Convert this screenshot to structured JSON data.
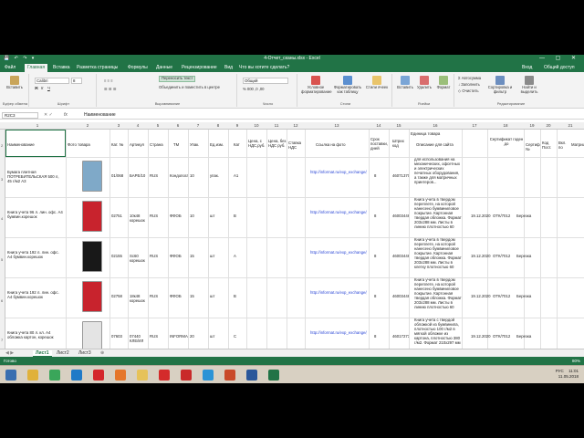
{
  "window": {
    "title": "4-Отчет_сканы.xlsx - Excel",
    "quick_access": "💾 ↶ ↷ ▾",
    "controls": "— ▢ ✕"
  },
  "tabs": [
    "Файл",
    "Главная",
    "Вставка",
    "Разметка страницы",
    "Формулы",
    "Данные",
    "Рецензирование",
    "Вид",
    "Что вы хотите сделать?"
  ],
  "account": {
    "sign_in": "Вход",
    "share": "Общий доступ"
  },
  "ribbon": {
    "paste": "Вставить",
    "font_name": "Calibri",
    "font_size": "8",
    "wrap_text": "Переносить текст",
    "merge": "Объединить и поместить в центре",
    "number_format": "Общий",
    "cond_format": "Условное форматирование",
    "format_table": "Форматировать как таблицу",
    "cell_styles": "Стили ячеек",
    "insert": "Вставить",
    "delete": "Удалить",
    "format": "Формат",
    "autosum": "Автосумма",
    "fill": "Заполнить",
    "clear": "Очистить",
    "sort": "Сортировка и фильтр",
    "find": "Найти и выделить",
    "groups": [
      "Буфер обмена",
      "Шрифт",
      "Выравнивание",
      "Число",
      "Стили",
      "Ячейки",
      "Редактирование"
    ]
  },
  "formula_bar": {
    "name_box": "R2C3",
    "fx": "fx",
    "value": "Наименование"
  },
  "columns": [
    "1",
    "2",
    "3",
    "4",
    "5",
    "6",
    "7",
    "8",
    "9",
    "10",
    "11",
    "12",
    "13",
    "14",
    "15",
    "16",
    "17",
    "18",
    "19",
    "20",
    "21"
  ],
  "header_row": {
    "c1": "Наименование",
    "c2": "Фото товара",
    "c3": "Кат. №",
    "c4": "Артикул",
    "c5": "Страна",
    "c6": "ТМ",
    "c7": "Упак.",
    "c8": "Ед.изм.",
    "c9": "Кат",
    "c10": "Цена, с НДС,руб.",
    "c11": "Цена, без НДС руб.",
    "c12": "Ставка НДС",
    "c13": "Ссылка на фото",
    "c14": "Срок поставки, дней",
    "c15": "Штрих код",
    "c16": "Описание для сайта",
    "c16_top": "Единица товара",
    "c17": "Сертификат годен до",
    "c18": "Сертификат №",
    "c19": "Код Пост.",
    "c20": "Вкл. по",
    "c21": "Матрица"
  },
  "rows": [
    {
      "name": "Бумага плитная ПОТРЕБИТЕЛЬСКАЯ 500 л, 45 г/м2 А3",
      "cat": "01/068",
      "art": "БАРЕ/10",
      "country": "RUS",
      "tm": "Кондопога",
      "pack": "10",
      "unit": "упак.",
      "kat": "А1",
      "link": "http://informat.ru/exp_exchange/photo/Main/19968.jpg",
      "term": "8",
      "barcode": "460713702",
      "desc": "для использования на механических, офсетных и электрических печатных оборудования, а также для матричных принтеров...",
      "cert_date": "",
      "cert": "",
      "color": "#7fa9c8"
    },
    {
      "name": "Книга учета 96 л. лин. офс. А4 бумвин.корешок",
      "cat": "02751",
      "art": "10к48 корешок",
      "country": "RUS",
      "tm": "ФФОБ",
      "pack": "10",
      "unit": "шт",
      "kat": "В",
      "link": "http://informat.ru/exp_exchange/photo/Main/22751.jpg",
      "term": "8",
      "barcode": "460034487",
      "desc": "Книга учета в твердом переплете, на которой нанесено бумвиниловое покрытие. Картонная твердая обложка. Формат 203х288 мм. Листы в линию плотностью 60",
      "cert_date": "19.12.2020",
      "cert": "ОТК/7012",
      "vkl": "Березка",
      "color": "#c8232d"
    },
    {
      "name": "Книга учета 192 л. лин. офс. А4 бумвин.корешок",
      "cat": "02155",
      "art": "Sc60 корешок",
      "country": "RUS",
      "tm": "ФФОБ",
      "pack": "15",
      "unit": "шт",
      "kat": "А",
      "link": "http://informat.ru/exp_exchange/photo/Main/22155.jpg",
      "term": "8",
      "barcode": "460034482",
      "desc": "Книга учета в твердом переплете, на которой нанесено бумвиниловое покрытие. Картонная твердая обложка. Формат 203х288 мм. Листы в клетку плотностью 60",
      "cert_date": "19.12.2020",
      "cert": "ОТК/7012",
      "vkl": "Березка",
      "color": "#181818"
    },
    {
      "name": "Книга учета 192 л. лин. офс. А4 бумвин.корешок",
      "cat": "02758",
      "art": "18к48 корешок",
      "country": "RUS",
      "tm": "ФФОБ",
      "pack": "15",
      "unit": "шт",
      "kat": "В",
      "link": "http://informat.ru/exp_exchange/photo/Main/22758.jpg",
      "term": "8",
      "barcode": "460034485",
      "desc": "Книга учета в твердом переплете, на которой нанесено бумвиниловое покрытие. Картонная твердая обложка. Формат 203х288 мм. Листы в линию плотностью 60",
      "cert_date": "19.12.2020",
      "cert": "ОТК/7012",
      "vkl": "Березка",
      "color": "#c8232d"
    },
    {
      "name": "Книга учета 80 л. кл. А4 обложка картон, корешок",
      "cat": "07603",
      "art": "07440 КЛЕ/ИЛ",
      "country": "RUS",
      "tm": "INFORMA",
      "pack": "20",
      "unit": "шт",
      "kat": "С",
      "link": "http://informat.ru/exp_exchange/photo/Main/29603.jpg",
      "term": "8",
      "barcode": "460172734",
      "desc": "Книга учета с твердой обложкой из бумвинила, плотностью 100 г/м2 в мягкой обложке из картона, плотностью 380 г/м2. Формат 210х297 мм",
      "cert_date": "19.12.2020",
      "cert": "ОТК/7012",
      "vkl": "Березка",
      "color": "#e4e4e4"
    }
  ],
  "sheets": [
    "Лист1",
    "Лист2",
    "Лист3"
  ],
  "status": {
    "ready": "Готово",
    "zoom": "80%"
  },
  "taskbar": {
    "lang": "РУС",
    "time": "11:01",
    "date": "11.05.2018",
    "icons": [
      {
        "name": "start-icon",
        "color": "#3a6fb0"
      },
      {
        "name": "file-manager-icon",
        "color": "#e0b13a"
      },
      {
        "name": "chrome-icon",
        "color": "#3aa65a"
      },
      {
        "name": "ie-icon",
        "color": "#1f7ac7"
      },
      {
        "name": "opera-icon",
        "color": "#d4262b"
      },
      {
        "name": "firefox-icon",
        "color": "#e5762a"
      },
      {
        "name": "folder-icon",
        "color": "#e6c25a"
      },
      {
        "name": "yandex-icon",
        "color": "#d42b2b"
      },
      {
        "name": "pdf-icon",
        "color": "#c92a2a"
      },
      {
        "name": "skype-icon",
        "color": "#2b93d6"
      },
      {
        "name": "media-icon",
        "color": "#c94a2a"
      },
      {
        "name": "word-icon",
        "color": "#2a579a"
      },
      {
        "name": "excel-icon",
        "color": "#217346"
      }
    ]
  }
}
